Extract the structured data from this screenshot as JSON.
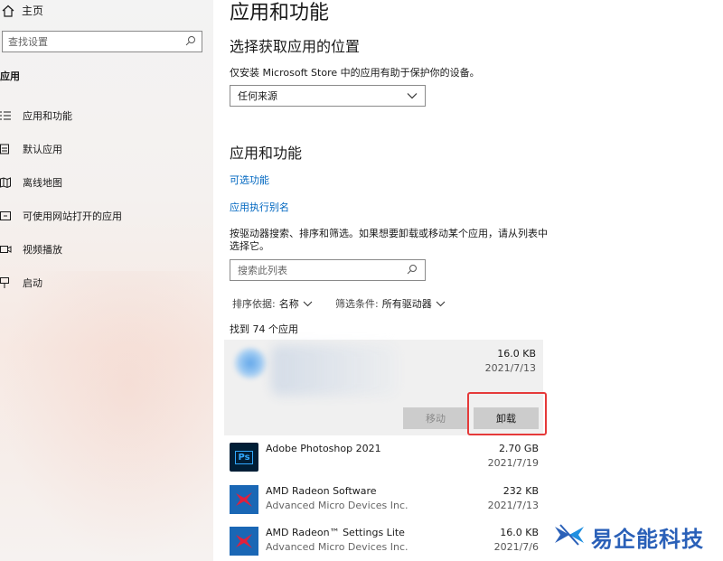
{
  "sidebar": {
    "home_label": "主页",
    "search_placeholder": "查找设置",
    "section_label": "应用",
    "items": [
      {
        "label": "应用和功能",
        "icon": "apps-list-icon"
      },
      {
        "label": "默认应用",
        "icon": "default-apps-icon"
      },
      {
        "label": "离线地图",
        "icon": "map-icon"
      },
      {
        "label": "可使用网站打开的应用",
        "icon": "web-apps-icon"
      },
      {
        "label": "视频播放",
        "icon": "video-icon"
      },
      {
        "label": "启动",
        "icon": "startup-icon"
      }
    ]
  },
  "main": {
    "page_title": "应用和功能",
    "install_source": {
      "heading": "选择获取应用的位置",
      "description": "仅安装 Microsoft Store 中的应用有助于保护你的设备。",
      "selected": "任何来源"
    },
    "apps_section": {
      "heading": "应用和功能",
      "optional_features_link": "可选功能",
      "alias_link": "应用执行别名",
      "instructions": "按驱动器搜索、排序和筛选。如果想要卸载或移动某个应用，请从列表中选择它。",
      "search_placeholder": "搜索此列表",
      "sort_label": "排序依据:",
      "sort_value": "名称",
      "filter_label": "筛选条件:",
      "filter_value": "所有驱动器",
      "found_count": "找到 74 个应用"
    },
    "selected_app": {
      "size": "16.0 KB",
      "date": "2021/7/13",
      "move_label": "移动",
      "uninstall_label": "卸载"
    },
    "apps": [
      {
        "name": "Adobe Photoshop 2021",
        "publisher": "",
        "size": "2.70 GB",
        "date": "2021/7/19",
        "icon": "photoshop-icon",
        "icon_text": "Ps"
      },
      {
        "name": "AMD Radeon Software",
        "publisher": "Advanced Micro Devices Inc.",
        "size": "232 KB",
        "date": "2021/7/13",
        "icon": "amd-radeon-icon"
      },
      {
        "name": "AMD Radeon™ Settings Lite",
        "publisher": "Advanced Micro Devices Inc.",
        "size": "16.0 KB",
        "date": "2021/7/6",
        "icon": "amd-radeon-icon"
      }
    ]
  },
  "watermark": {
    "text": "易企能科技"
  },
  "colors": {
    "link": "#0067c0",
    "highlight_box": "#e53a3a",
    "card_bg": "#f0f0f0"
  }
}
